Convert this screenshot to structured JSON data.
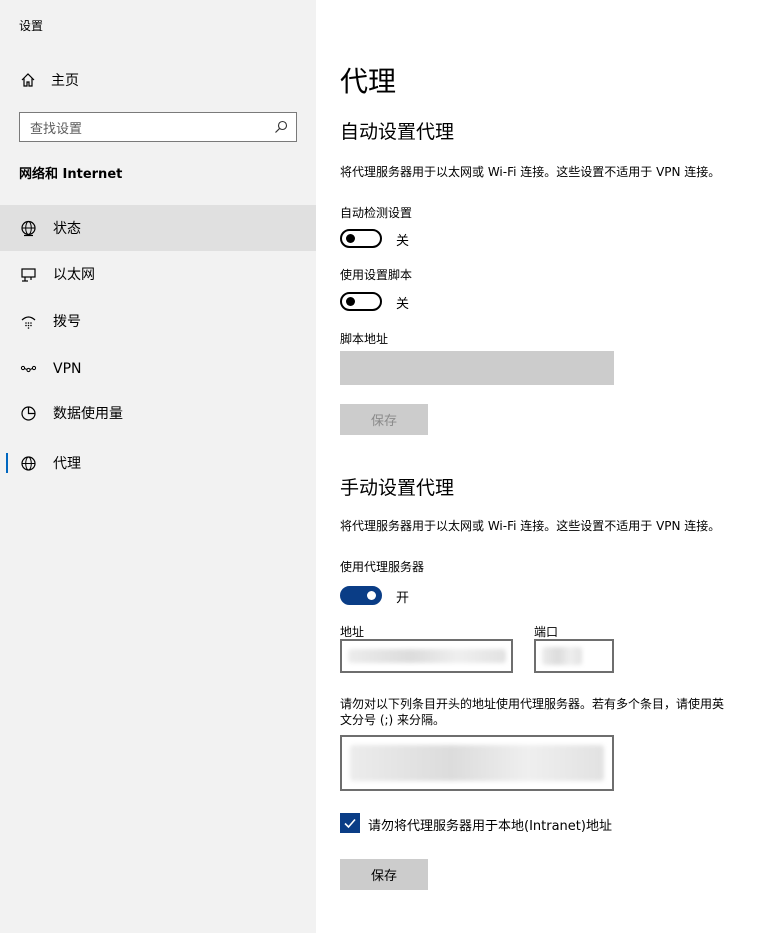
{
  "window": {
    "title": "设置"
  },
  "sidebar": {
    "home_label": "主页",
    "search_placeholder": "查找设置",
    "section_label": "网络和 Internet",
    "items": [
      {
        "label": "状态",
        "icon": "globe-icon",
        "selected": true
      },
      {
        "label": "以太网",
        "icon": "ethernet-icon"
      },
      {
        "label": "拨号",
        "icon": "dialup-icon"
      },
      {
        "label": "VPN",
        "icon": "vpn-icon"
      },
      {
        "label": "数据使用量",
        "icon": "data-usage-icon"
      },
      {
        "label": "代理",
        "icon": "globe-icon",
        "active": true
      }
    ]
  },
  "main": {
    "title": "代理",
    "auto": {
      "heading": "自动设置代理",
      "description": "将代理服务器用于以太网或 Wi-Fi 连接。这些设置不适用于 VPN 连接。",
      "detect_label": "自动检测设置",
      "detect_state": "关",
      "script_label": "使用设置脚本",
      "script_state": "关",
      "address_label": "脚本地址",
      "save_label": "保存"
    },
    "manual": {
      "heading": "手动设置代理",
      "description": "将代理服务器用于以太网或 Wi-Fi 连接。这些设置不适用于 VPN 连接。",
      "use_proxy_label": "使用代理服务器",
      "use_proxy_state": "开",
      "address_label": "地址",
      "port_label": "端口",
      "exceptions_line1": "请勿对以下列条目开头的地址使用代理服务器。若有多个条目，请使用英",
      "exceptions_line2": "文分号 (;) 来分隔。",
      "bypass_local_label": "请勿将代理服务器用于本地(Intranet)地址",
      "bypass_local_checked": true,
      "save_label": "保存"
    }
  },
  "colors": {
    "accent": "#0a3d86",
    "sidebar_bg": "#f2f2f2",
    "selected_bg": "#e0e0e0"
  }
}
